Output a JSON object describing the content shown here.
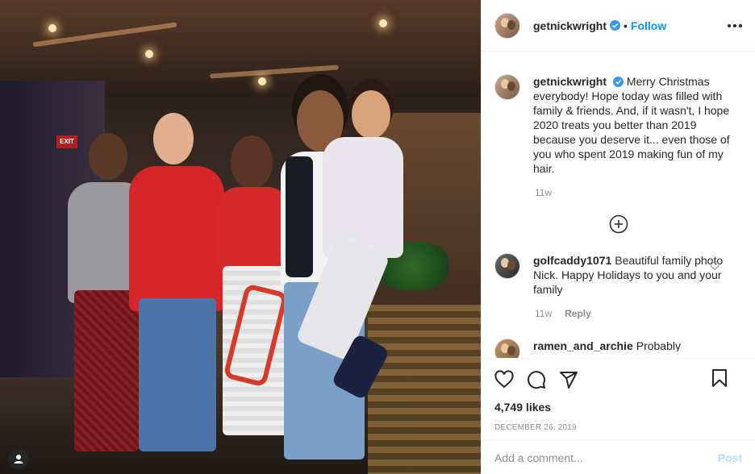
{
  "post": {
    "username": "getnickwright",
    "follow_label": "Follow",
    "separator": "•",
    "caption": "Merry Christmas everybody! Hope today was filled with family & friends. And, if it wasn't, I hope 2020 treats you better than 2019 because you deserve it... even those of you who spent 2019 making fun of my hair.",
    "caption_time": "11w",
    "likes": "4,749 likes",
    "date": "December 26, 2019",
    "exit_sign": "EXIT"
  },
  "comments": [
    {
      "username": "golfcaddy1071",
      "text": "Beautiful family photo Nick. Happy Holidays to you and your family",
      "time": "11w",
      "reply_label": "Reply"
    },
    {
      "username": "ramen_and_archie",
      "text": "Probably"
    }
  ],
  "add_comment": {
    "placeholder": "Add a comment...",
    "post_label": "Post"
  },
  "colors": {
    "accent": "#0095f6",
    "post_disabled": "#b2dffc",
    "muted": "#8e8e8e"
  },
  "icons": [
    "verified-badge-icon",
    "more-options-icon",
    "load-more-comments-icon",
    "like-icon",
    "comment-icon",
    "share-icon",
    "save-icon",
    "profile-badge-icon"
  ]
}
